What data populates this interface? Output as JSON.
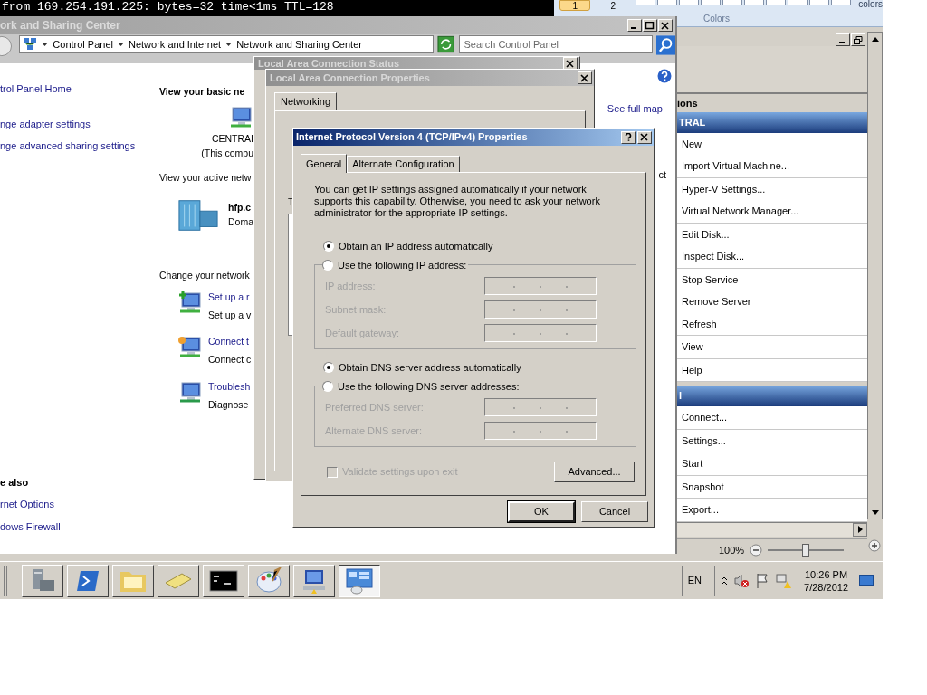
{
  "console": {
    "lines": [
      "from 169.254.191.225: bytes=32 time<1ms TTL=128"
    ]
  },
  "paint_ribbon": {
    "buttons": [
      {
        "label": "1",
        "selected": true
      },
      {
        "label": "2",
        "selected": false
      }
    ],
    "group_label": "Colors",
    "cut_label": "colors"
  },
  "hyperv": {
    "actions_header": "ions",
    "sections": [
      {
        "title": "TRAL",
        "groups": [
          [
            "New",
            "Import Virtual Machine..."
          ],
          [
            "Hyper-V Settings...",
            "Virtual Network Manager..."
          ],
          [
            "Edit Disk...",
            "Inspect Disk..."
          ],
          [
            "Stop Service",
            "Remove Server",
            "Refresh"
          ],
          [
            "View"
          ],
          [
            "Help"
          ]
        ]
      },
      {
        "title": "l",
        "groups": [
          [
            "Connect..."
          ],
          [
            "Settings..."
          ],
          [
            "Start"
          ],
          [
            "Snapshot"
          ],
          [
            "Export..."
          ]
        ]
      }
    ],
    "zoom": {
      "reading": "100%",
      "level": 0.5
    }
  },
  "network_center": {
    "title": "ork and Sharing Center",
    "breadcrumb": [
      "Control Panel",
      "Network and Internet",
      "Network and Sharing Center"
    ],
    "search": {
      "placeholder": "Search Control Panel"
    },
    "left_links": [
      "trol Panel Home",
      "nge adapter settings",
      "nge advanced sharing settings"
    ],
    "see_also": {
      "title": "e also",
      "links": [
        "rnet Options",
        "dows Firewall"
      ]
    },
    "basic_heading": "View your basic ne",
    "computer": {
      "name": "CENTRAI",
      "note": "(This compu"
    },
    "active_heading": "View your active netw",
    "network": {
      "name": "hfp.c",
      "type": "Doma"
    },
    "change_heading": "Change your network",
    "tasks": [
      {
        "kind": "add",
        "link": "Set up a r",
        "description": "Set up a v"
      },
      {
        "kind": "connect",
        "link": "Connect t",
        "description": "Connect c"
      },
      {
        "kind": "troubleshoot",
        "link": "Troublesh",
        "description": "Diagnose"
      }
    ],
    "see_full_map": "See full map",
    "fragment": "ct"
  },
  "status_window": {
    "title": "Local Area Connection Status"
  },
  "properties_window": {
    "title": "Local Area Connection Properties",
    "tabs": [
      {
        "label": "Networking",
        "selected": true
      }
    ],
    "fragment": "T"
  },
  "ipv4": {
    "title": "Internet Protocol Version 4 (TCP/IPv4) Properties",
    "tabs": [
      {
        "label": "General",
        "selected": true
      },
      {
        "label": "Alternate Configuration",
        "selected": false
      }
    ],
    "description": "You can get IP settings assigned automatically if your network supports this capability. Otherwise, you need to ask your network administrator for the appropriate IP settings.",
    "sections": [
      {
        "auto": {
          "label": "Obtain an IP address automatically",
          "selected": true
        },
        "manual": {
          "label": "Use the following IP address:",
          "selected": false
        },
        "fields": [
          {
            "label": "IP address:",
            "disabled": true
          },
          {
            "label": "Subnet mask:",
            "disabled": true
          },
          {
            "label": "Default gateway:",
            "disabled": true
          }
        ]
      },
      {
        "auto": {
          "label": "Obtain DNS server address automatically",
          "selected": true
        },
        "manual": {
          "label": "Use the following DNS server addresses:",
          "selected": false
        },
        "fields": [
          {
            "label": "Preferred DNS server:",
            "disabled": true
          },
          {
            "label": "Alternate DNS server:",
            "disabled": true
          }
        ]
      }
    ],
    "validate": {
      "label": "Validate settings upon exit",
      "checked": false,
      "disabled": true
    },
    "advanced": "Advanced...",
    "ok": "OK",
    "cancel": "Cancel"
  },
  "taskbar": {
    "buttons": [
      {
        "kind": "server",
        "selected": false
      },
      {
        "kind": "shell",
        "selected": false
      },
      {
        "kind": "folder",
        "selected": false
      },
      {
        "kind": "note",
        "selected": false
      },
      {
        "kind": "console",
        "selected": false
      },
      {
        "kind": "paint",
        "selected": false
      },
      {
        "kind": "network",
        "selected": false
      },
      {
        "kind": "hyperv",
        "selected": true
      }
    ],
    "language": "EN",
    "time": "10:26 PM",
    "date": "7/28/2012"
  }
}
